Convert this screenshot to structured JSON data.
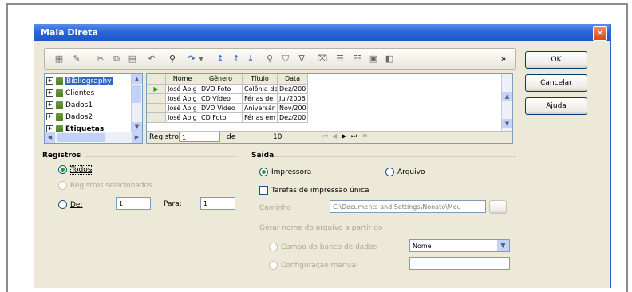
{
  "window": {
    "title": "Mala Direta",
    "close": "✕"
  },
  "buttons": {
    "ok": "OK",
    "cancel": "Cancelar",
    "help": "Ajuda"
  },
  "tree": {
    "items": [
      {
        "label": "Bibliography",
        "selected": true
      },
      {
        "label": "Clientes"
      },
      {
        "label": "Dados1"
      },
      {
        "label": "Dados2"
      },
      {
        "label": "Etiquetas"
      }
    ]
  },
  "grid": {
    "columns": [
      "Nome",
      "Gênero",
      "Título",
      "Data"
    ],
    "rows": [
      [
        "José Abig",
        "DVD Foto",
        "Colônia de",
        "Dez/200"
      ],
      [
        "José Abig",
        "CD Vídeo",
        "Férias de",
        "Jul/2006"
      ],
      [
        "José Abig",
        "DVD Vídeo",
        "Aniversár",
        "Nov/200"
      ],
      [
        "José Abig",
        "CD Foto",
        "Férias em",
        "Dez/200"
      ]
    ],
    "nav": {
      "label": "Registro",
      "current": "1",
      "of": "de",
      "total": "10"
    }
  },
  "registros": {
    "title": "Registros",
    "todos": "Todos",
    "selecionados": "Registros selecionados",
    "de_label": "De:",
    "de_value": "1",
    "para_label": "Para:",
    "para_value": "1"
  },
  "saida": {
    "title": "Saída",
    "impressora": "Impressora",
    "arquivo": "Arquivo",
    "tarefas": "Tarefas de impressão única",
    "caminho_label": "Caminho",
    "caminho_value": "C:\\Documents and Settings\\Nonato\\Meu",
    "browse": "...",
    "gerar": "Gerar nome do arquivo a partir do",
    "campo_banco": "Campo do banco de dados",
    "campo_value": "Nome",
    "config_manual": "Configuração manual"
  },
  "colors": {
    "title_bar": "#2b65d8",
    "dialog_bg": "#ece9d8",
    "close": "#d64a1c",
    "radio_on": "#21a121"
  }
}
